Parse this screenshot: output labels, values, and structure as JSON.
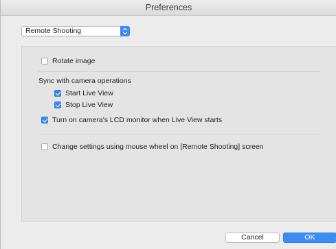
{
  "window": {
    "title": "Preferences"
  },
  "category_select": {
    "value": "Remote Shooting"
  },
  "options": {
    "rotate_image": {
      "label": "Rotate image",
      "checked": false
    },
    "sync_heading": "Sync with camera operations",
    "start_live_view": {
      "label": "Start Live View",
      "checked": true
    },
    "stop_live_view": {
      "label": "Stop Live View",
      "checked": true
    },
    "lcd_monitor": {
      "label": "Turn on camera's LCD monitor when Live View starts",
      "checked": true
    },
    "mouse_wheel": {
      "label": "Change settings using mouse wheel on [Remote Shooting] screen",
      "checked": false
    }
  },
  "buttons": {
    "cancel": "Cancel",
    "ok": "OK"
  }
}
